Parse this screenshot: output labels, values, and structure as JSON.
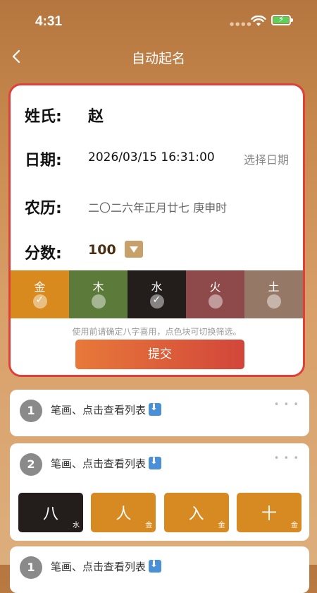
{
  "status": {
    "time": "4:31"
  },
  "nav": {
    "title": "自动起名"
  },
  "form": {
    "surname_label": "姓氏:",
    "surname": "赵",
    "date_label": "日期:",
    "date": "2026/03/15 16:31:00",
    "pick_date": "选择日期",
    "lunar_label": "农历:",
    "lunar": "二〇二六年正月廿七 庚申时",
    "score_label": "分数:",
    "score": "100"
  },
  "elements": [
    {
      "name": "金",
      "color": "#d98a1f",
      "checked": true
    },
    {
      "name": "木",
      "color": "#5c7a3a",
      "checked": false
    },
    {
      "name": "水",
      "color": "#231e1c",
      "checked": true
    },
    {
      "name": "火",
      "color": "#8e4a4a",
      "checked": false
    },
    {
      "name": "土",
      "color": "#957865",
      "checked": false
    }
  ],
  "hint": "使用前请确定八字喜用，点色块可切换筛选。",
  "submit_label": "提交",
  "cards": [
    {
      "num": "1",
      "title": "笔画、点击查看列表"
    },
    {
      "num": "2",
      "title": "笔画、点击查看列表",
      "chars": [
        {
          "char": "八",
          "element": "水",
          "dark": true
        },
        {
          "char": "人",
          "element": "金",
          "dark": false
        },
        {
          "char": "入",
          "element": "金",
          "dark": false
        },
        {
          "char": "十",
          "element": "金",
          "dark": false
        }
      ]
    },
    {
      "num": "1",
      "title": "笔画、点击查看列表"
    }
  ]
}
